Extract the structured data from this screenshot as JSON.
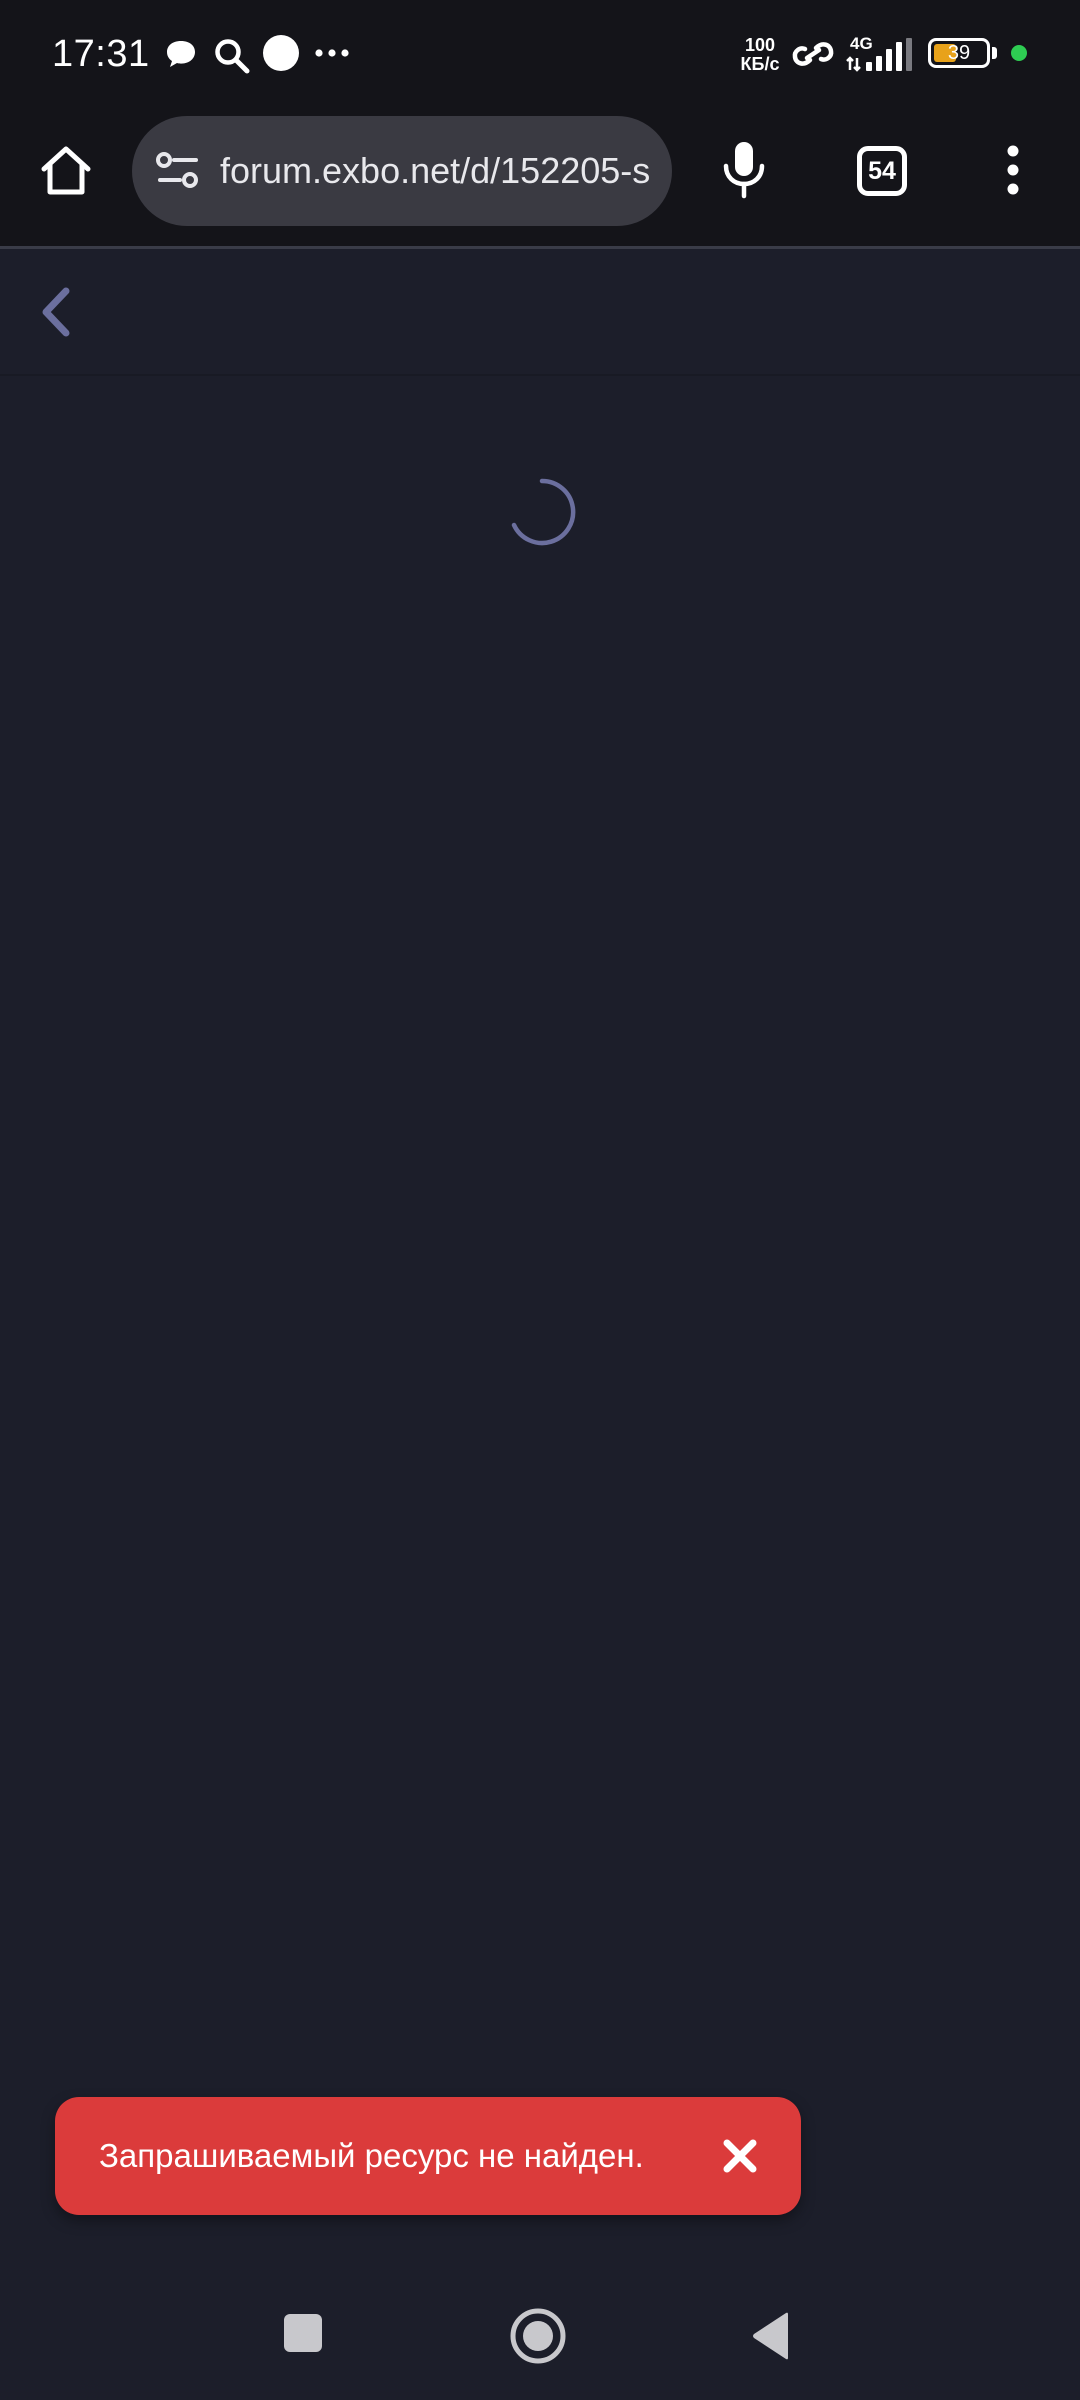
{
  "status_bar": {
    "time": "17:31",
    "network_speed_value": "100",
    "network_speed_unit": "КБ/с",
    "network_type": "4G",
    "battery_level": "39",
    "icons": [
      "chat-bubble-icon",
      "search-icon",
      "circle-icon",
      "more-dots-icon",
      "link-icon",
      "signal-icon",
      "battery-icon"
    ]
  },
  "browser": {
    "url": "forum.exbo.net/d/152205-s",
    "tabs_count": "54",
    "icons": [
      "home-icon",
      "site-settings-icon",
      "mic-icon",
      "tabs-icon",
      "menu-icon"
    ]
  },
  "page": {
    "header_icons": [
      "back-chevron-icon"
    ],
    "loading": true
  },
  "toast": {
    "message": "Запрашиваемый ресурс не найден.",
    "color": "#db3b3b"
  },
  "nav_bar": {
    "buttons": [
      "recents",
      "home",
      "back"
    ]
  },
  "colors": {
    "background": "#1c1e2a",
    "toolbar": "#141419",
    "accent_muted": "#6b6f9e"
  }
}
